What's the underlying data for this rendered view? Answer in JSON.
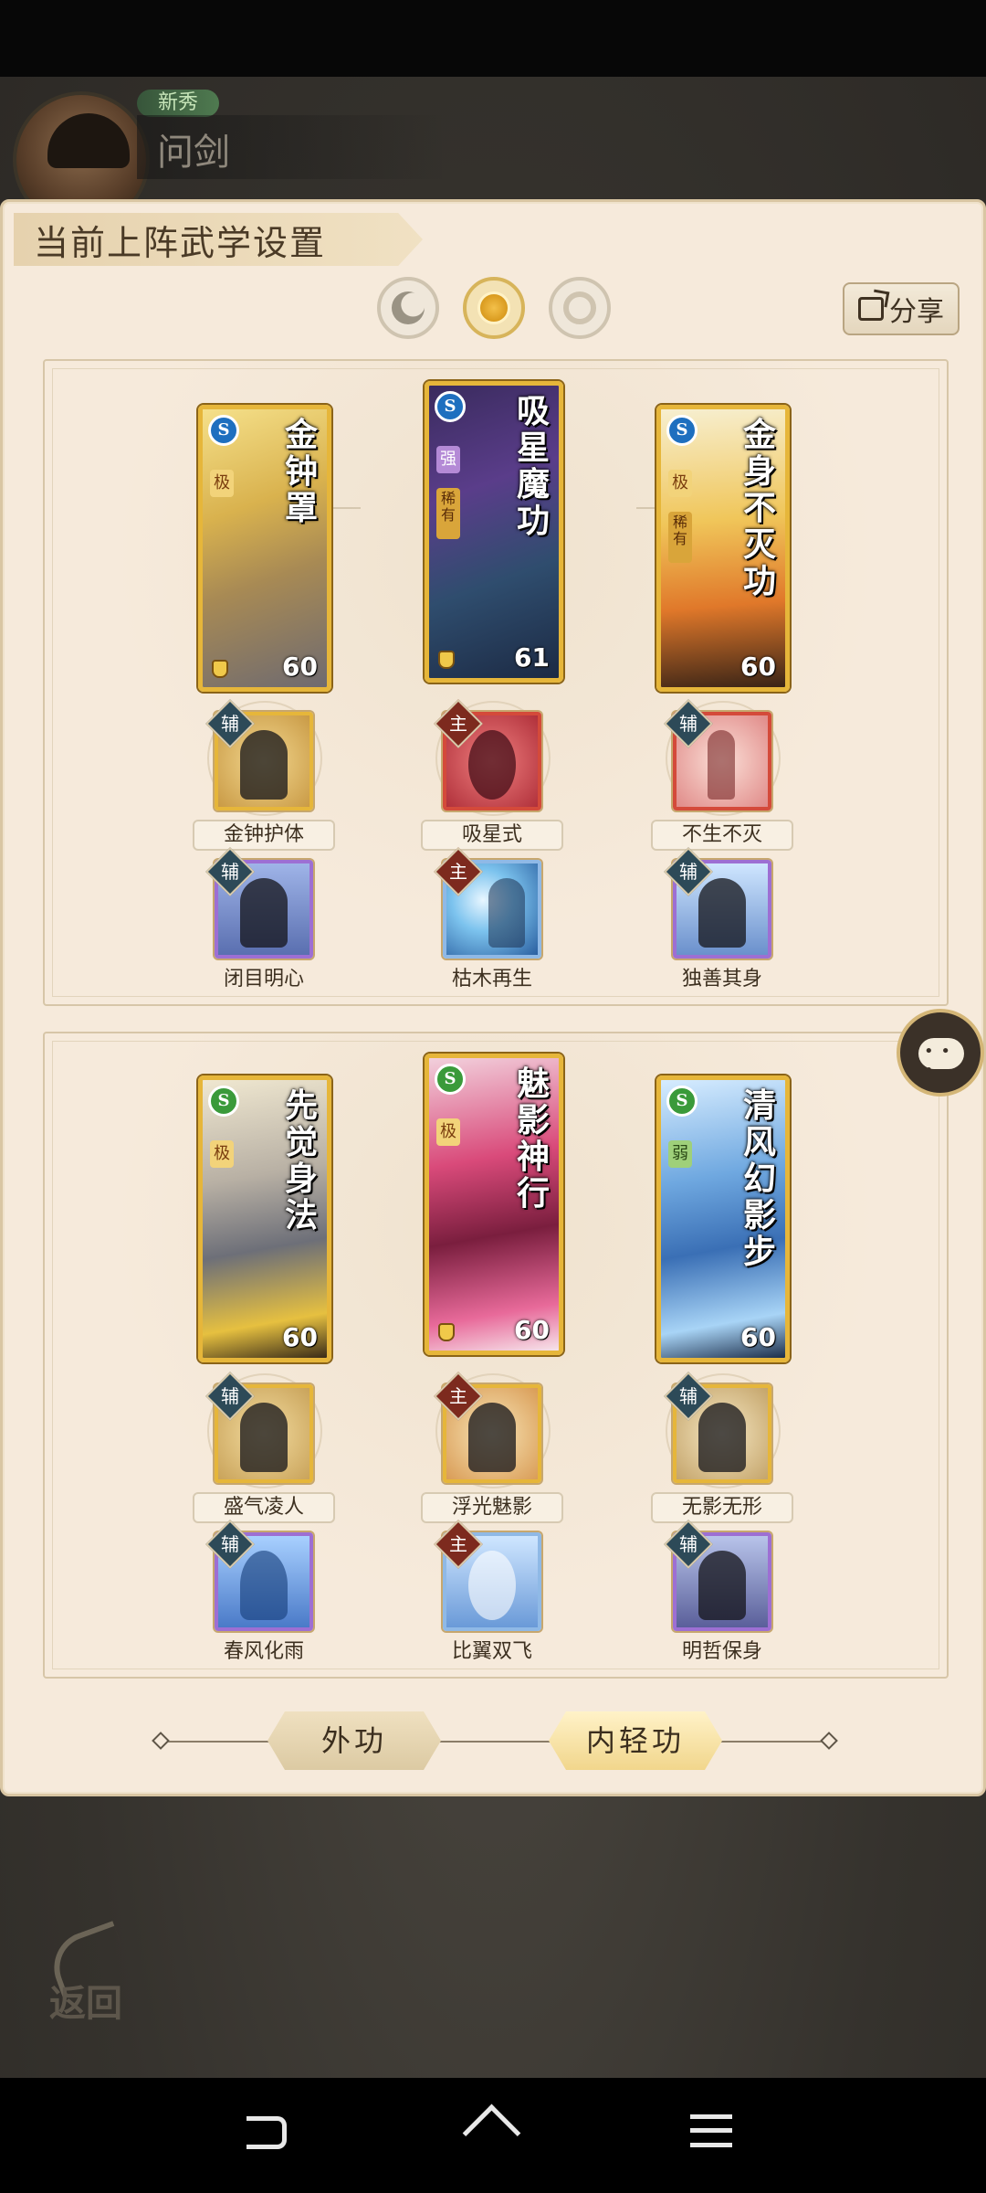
{
  "header": {
    "rank_badge": "新秀",
    "player_name": "问剑"
  },
  "panel": {
    "title": "当前上阵武学设置",
    "share_label": "分享"
  },
  "outer_section": {
    "cards": [
      {
        "name": "金钟罩",
        "level": "60",
        "type_icon": "S",
        "grade": "极",
        "rarity": ""
      },
      {
        "name": "吸星魔功",
        "level": "61",
        "type_icon": "S",
        "grade": "强",
        "rarity": "稀有"
      },
      {
        "name": "金身不灭功",
        "level": "60",
        "type_icon": "S",
        "grade": "极",
        "rarity": "稀有"
      }
    ],
    "skills_row1": [
      {
        "label": "金钟护体",
        "role": "辅"
      },
      {
        "label": "吸星式",
        "role": "主"
      },
      {
        "label": "不生不灭",
        "role": "辅"
      }
    ],
    "skills_row2": [
      {
        "label": "闭目明心",
        "role": "辅"
      },
      {
        "label": "枯木再生",
        "role": "主"
      },
      {
        "label": "独善其身",
        "role": "辅"
      }
    ]
  },
  "inner_section": {
    "cards": [
      {
        "name": "先觉身法",
        "level": "60",
        "type_icon": "S",
        "grade": "极"
      },
      {
        "name": "魅影神行",
        "level": "60",
        "type_icon": "S",
        "grade": "极"
      },
      {
        "name": "清风幻影步",
        "level": "60",
        "type_icon": "S",
        "grade": "弱"
      }
    ],
    "skills_row1": [
      {
        "label": "盛气凌人",
        "role": "辅"
      },
      {
        "label": "浮光魅影",
        "role": "主"
      },
      {
        "label": "无影无形",
        "role": "辅"
      }
    ],
    "skills_row2": [
      {
        "label": "春风化雨",
        "role": "辅"
      },
      {
        "label": "比翼双飞",
        "role": "主"
      },
      {
        "label": "明哲保身",
        "role": "辅"
      }
    ]
  },
  "mode_buttons": {
    "outer": "外功",
    "inner": "内轻功"
  },
  "back_label": "返回",
  "colors": {
    "panel_bg": "#f6eadb",
    "card_border": "#e6b63a",
    "role_aux": "#2d4a58",
    "role_main": "#7d2a1e"
  },
  "icons": {
    "preset_tabs": [
      "moon-half-icon",
      "sun-icon",
      "ring-icon"
    ],
    "share": "share-icon",
    "chat": "chat-bubble-icon",
    "nav": [
      "nav-back-icon",
      "nav-home-icon",
      "nav-menu-icon"
    ]
  }
}
